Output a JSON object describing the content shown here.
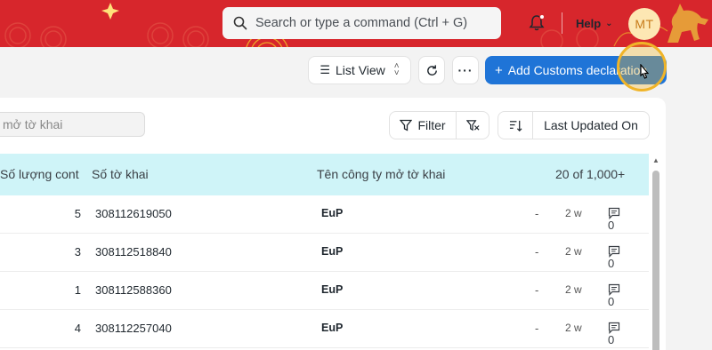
{
  "navbar": {
    "search_placeholder": "Search or type a command (Ctrl + G)",
    "help_label": "Help",
    "avatar_initials": "MT",
    "bg_color": "#d7262c"
  },
  "toolbar": {
    "list_view_label": "List View",
    "more_label": "···",
    "add_label": "Add Customs declaration",
    "add_color": "#1f74d7"
  },
  "filters": {
    "input_placeholder": "mở tờ khai",
    "filter_label": "Filter",
    "sort_label": "Last Updated On"
  },
  "table": {
    "columns": {
      "so_luong_cont": "Số lượng cont",
      "so_to_khai": "Số tờ khai",
      "ten_cong_ty": "Tên công ty mở tờ khai",
      "count": "20 of 1,000+"
    },
    "rows": [
      {
        "cont": "5",
        "so_to_khai": "308112619050",
        "cong_ty": "EuP",
        "dash": "-",
        "time": "2 w",
        "comments": "0"
      },
      {
        "cont": "3",
        "so_to_khai": "308112518840",
        "cong_ty": "EuP",
        "dash": "-",
        "time": "2 w",
        "comments": "0"
      },
      {
        "cont": "1",
        "so_to_khai": "308112588360",
        "cong_ty": "EuP",
        "dash": "-",
        "time": "2 w",
        "comments": "0"
      },
      {
        "cont": "4",
        "so_to_khai": "308112257040",
        "cong_ty": "EuP",
        "dash": "-",
        "time": "2 w",
        "comments": "0"
      }
    ]
  }
}
